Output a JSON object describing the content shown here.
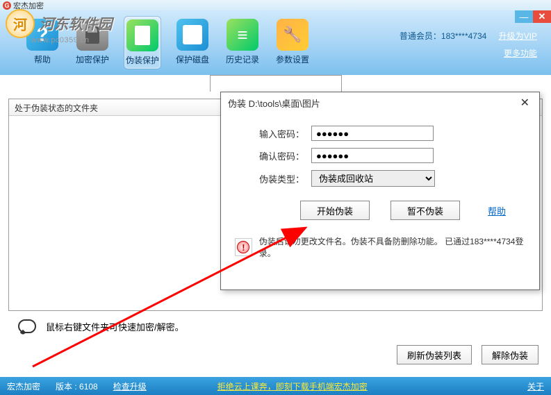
{
  "titlebar": {
    "text": "宏杰加密",
    "icon_label": "G"
  },
  "watermark": {
    "text": "河东软件园",
    "url": "www.pc0359.cn"
  },
  "toolbar": {
    "items": [
      {
        "label": "帮助",
        "name": "tool-help"
      },
      {
        "label": "加密保护",
        "name": "tool-encrypt"
      },
      {
        "label": "伪装保护",
        "name": "tool-disguise"
      },
      {
        "label": "保护磁盘",
        "name": "tool-disk"
      },
      {
        "label": "历史记录",
        "name": "tool-history"
      },
      {
        "label": "参数设置",
        "name": "tool-settings"
      }
    ]
  },
  "header": {
    "member_prefix": "普通会员：",
    "member_id": "183****4734",
    "upgrade_vip": "升级为VIP",
    "more_func": "更多功能"
  },
  "list": {
    "header": "处于伪装状态的文件夹"
  },
  "tip": {
    "text": "鼠标右键文件夹可快速加密/解密。"
  },
  "bottom": {
    "refresh": "刷新伪装列表",
    "undisguise": "解除伪装"
  },
  "statusbar": {
    "app_name": "宏杰加密",
    "version_label": "版本 : 6108",
    "check_update": "检查升级",
    "promo": "拒绝云上课奔，即刻下载手机端宏杰加密",
    "about": "关于"
  },
  "dialog": {
    "title": "伪装 D:\\tools\\桌面\\图片",
    "password_label": "输入密码：",
    "confirm_label": "确认密码：",
    "type_label": "伪装类型：",
    "type_value": "伪装成回收站",
    "password_mask": "●●●●●●",
    "start_btn": "开始伪装",
    "cancel_btn": "暂不伪装",
    "help": "帮助",
    "info_text": "伪装后请勿更改文件名。伪装不具备防删除功能。 已通过183****4734登录。"
  }
}
